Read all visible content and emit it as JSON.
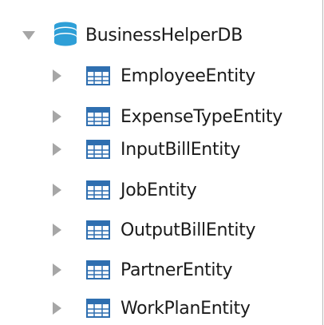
{
  "tree": {
    "database": {
      "label": "BusinessHelperDB",
      "icon": "database-icon",
      "expanded": true
    },
    "tables": [
      {
        "label": "EmployeeEntity",
        "icon": "table-icon",
        "expanded": false
      },
      {
        "label": "ExpenseTypeEntity",
        "icon": "table-icon",
        "expanded": false
      },
      {
        "label": "InputBillEntity",
        "icon": "table-icon",
        "expanded": false
      },
      {
        "label": "JobEntity",
        "icon": "table-icon",
        "expanded": false
      },
      {
        "label": "OutputBillEntity",
        "icon": "table-icon",
        "expanded": false
      },
      {
        "label": "PartnerEntity",
        "icon": "table-icon",
        "expanded": false
      },
      {
        "label": "WorkPlanEntity",
        "icon": "table-icon",
        "expanded": false
      }
    ]
  },
  "colors": {
    "expander": "#a6a6a6",
    "db_icon": "#2e9fd7",
    "table_icon": "#2f6fb0",
    "text": "#1a1a1a"
  }
}
